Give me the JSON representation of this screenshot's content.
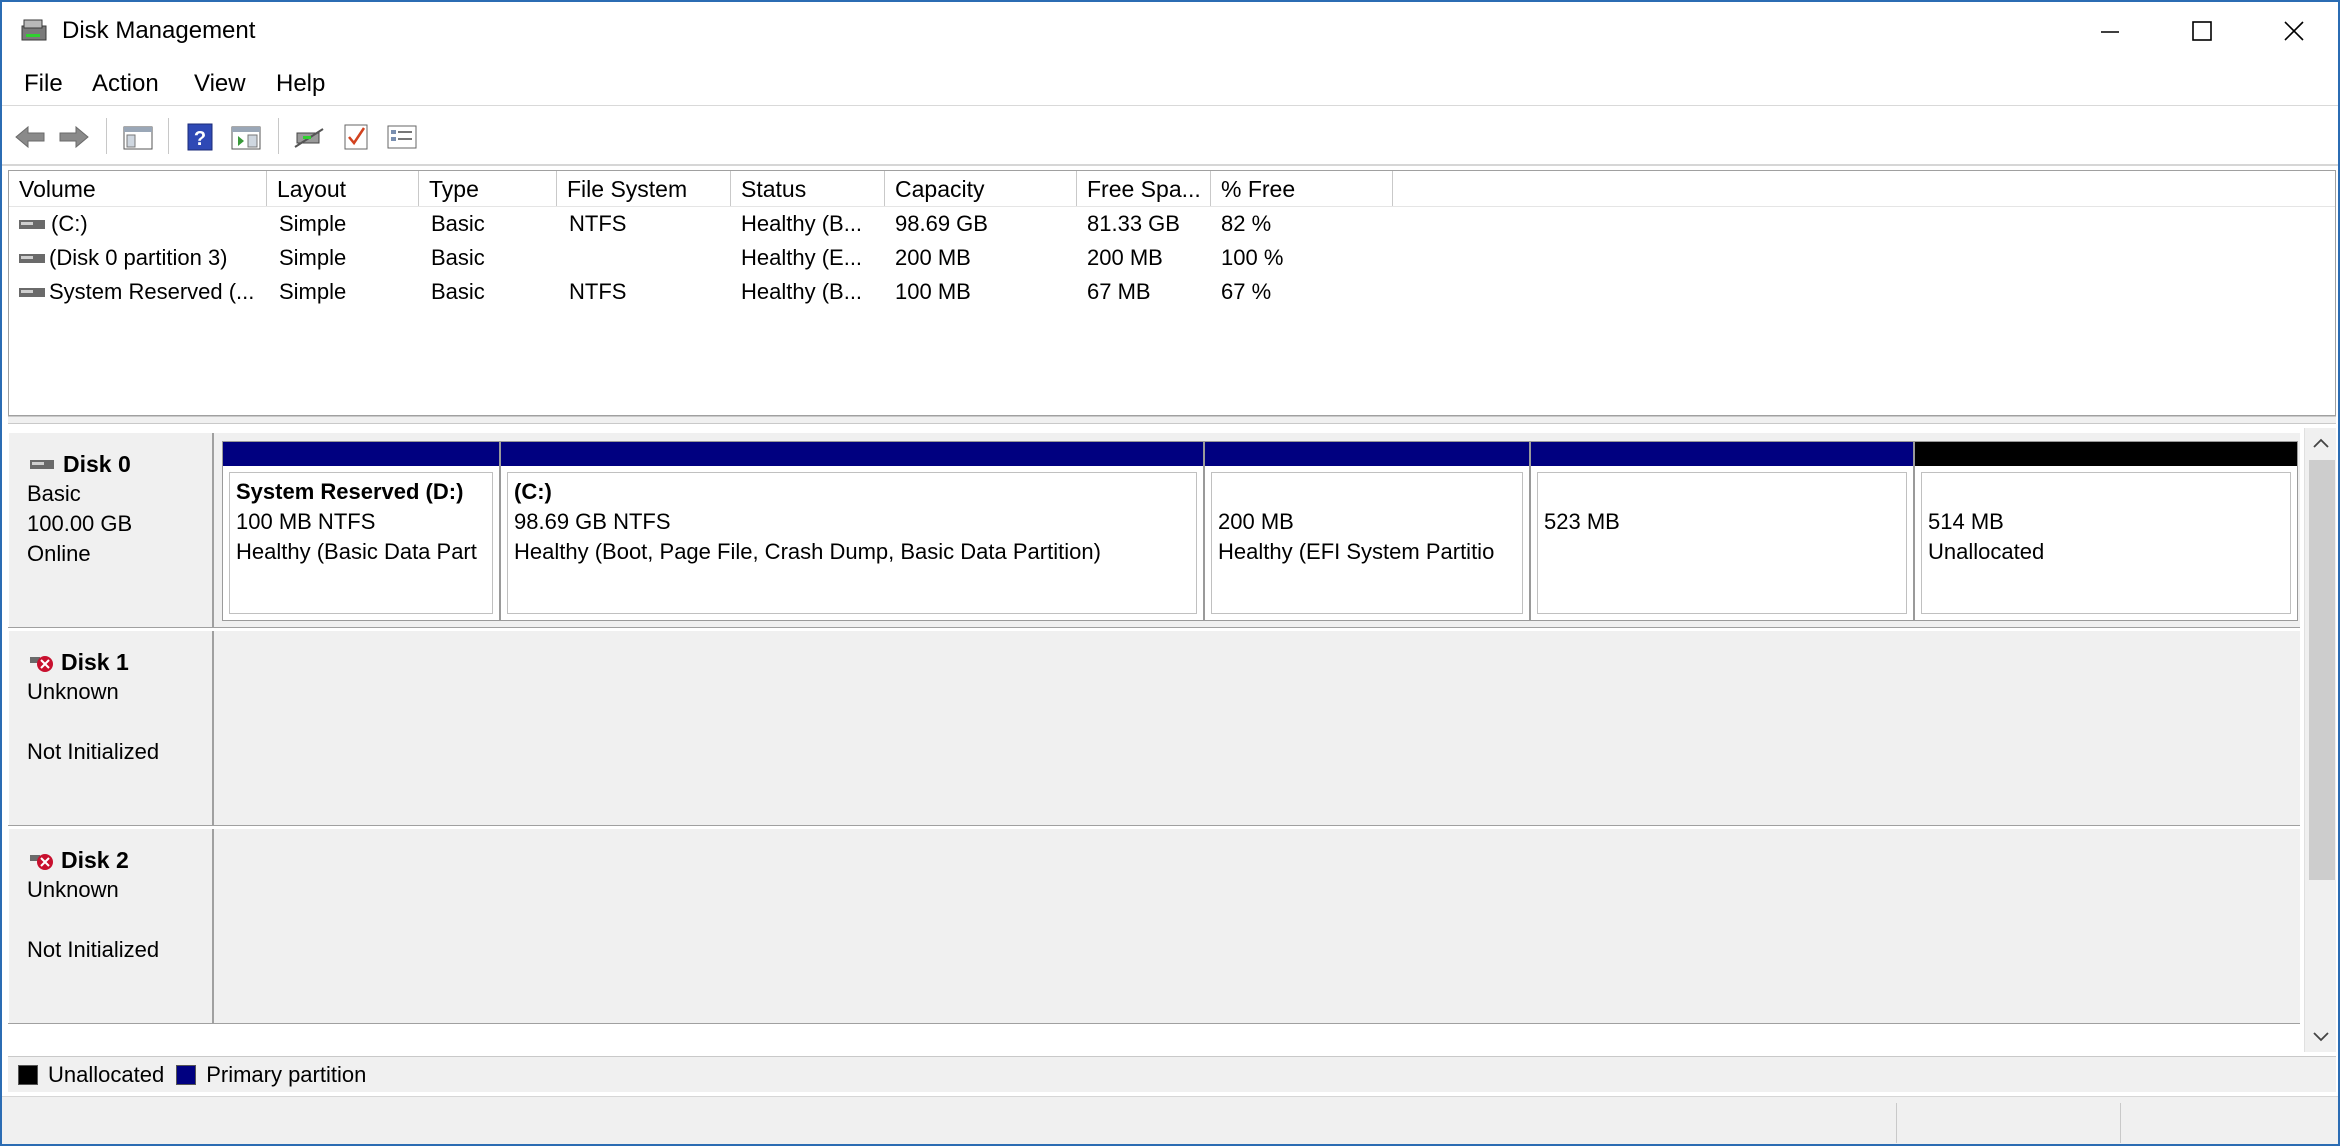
{
  "window": {
    "title": "Disk Management"
  },
  "menu": {
    "file": "File",
    "action": "Action",
    "view": "View",
    "help": "Help"
  },
  "toolbar": {
    "icons": [
      "back-arrow-icon",
      "forward-arrow-icon",
      "show-hide-tree-icon",
      "help-icon",
      "show-action-pane-icon",
      "connect-icon",
      "check-icon",
      "properties-icon"
    ]
  },
  "list": {
    "headers": {
      "volume": "Volume",
      "layout": "Layout",
      "type": "Type",
      "filesystem": "File System",
      "status": "Status",
      "capacity": "Capacity",
      "free": "Free Spa...",
      "percent": "% Free"
    },
    "rows": [
      {
        "volume": " (C:)",
        "layout": "Simple",
        "type": "Basic",
        "filesystem": "NTFS",
        "status": "Healthy (B...",
        "capacity": "98.69 GB",
        "free": "81.33 GB",
        "percent": "82 %"
      },
      {
        "volume": "(Disk 0 partition 3)",
        "layout": "Simple",
        "type": "Basic",
        "filesystem": "",
        "status": "Healthy (E...",
        "capacity": "200 MB",
        "free": "200 MB",
        "percent": "100 %"
      },
      {
        "volume": "System Reserved (...",
        "layout": "Simple",
        "type": "Basic",
        "filesystem": "NTFS",
        "status": "Healthy (B...",
        "capacity": "100 MB",
        "free": "67 MB",
        "percent": "67 %"
      }
    ]
  },
  "disks": [
    {
      "name": "Disk 0",
      "line1": "Basic",
      "line2": "100.00 GB",
      "line3": "Online",
      "partitions": [
        {
          "title": "System Reserved  (D:)",
          "line1": "100 MB NTFS",
          "line2": "Healthy (Basic Data Part"
        },
        {
          "title": " (C:)",
          "line1": "98.69 GB NTFS",
          "line2": "Healthy (Boot, Page File, Crash Dump, Basic Data Partition)"
        },
        {
          "title": "",
          "line1": "200 MB",
          "line2": "Healthy (EFI System Partitio"
        },
        {
          "title": "",
          "line1": "523 MB",
          "line2": ""
        },
        {
          "title": "",
          "line1": "514 MB",
          "line2": "Unallocated"
        }
      ]
    },
    {
      "name": "Disk 1",
      "line1": "Unknown",
      "line2": "",
      "line3": "Not Initialized"
    },
    {
      "name": "Disk 2",
      "line1": "Unknown",
      "line2": "",
      "line3": "Not Initialized"
    }
  ],
  "legend": {
    "unallocated": "Unallocated",
    "primary": "Primary partition"
  },
  "colors": {
    "primary": "#000080",
    "unallocated": "#000000",
    "window_border": "#2b6cb3"
  }
}
